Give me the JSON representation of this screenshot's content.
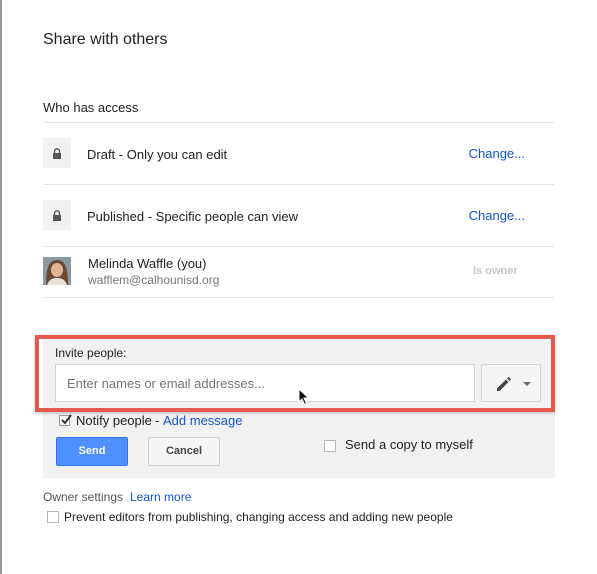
{
  "dialog": {
    "title": "Share with others"
  },
  "access": {
    "section_label": "Who has access",
    "rows": [
      {
        "icon": "lock-icon",
        "text": "Draft - Only you can edit",
        "action": "Change..."
      },
      {
        "icon": "lock-icon",
        "text": "Published - Specific people can view",
        "action": "Change..."
      }
    ],
    "person": {
      "name": "Melinda Waffle (you)",
      "email": "wafflem@calhounisd.org",
      "role": "Is owner"
    }
  },
  "invite": {
    "label": "Invite people:",
    "placeholder": "Enter names or email addresses...",
    "permission_icon": "pencil-icon",
    "notify_label": "Notify people",
    "notify_separator": "-",
    "add_message": "Add message",
    "notify_checked": true,
    "send_label": "Send",
    "cancel_label": "Cancel",
    "copy_label": "Send a copy to myself",
    "copy_checked": false
  },
  "owner_settings": {
    "label": "Owner settings",
    "learn_more": "Learn more",
    "prevent_label": "Prevent editors from publishing, changing access and adding new people",
    "prevent_checked": false
  },
  "colors": {
    "link": "#1155cc",
    "primary_button": "#4d90fe",
    "highlight": "#e45a4f"
  }
}
